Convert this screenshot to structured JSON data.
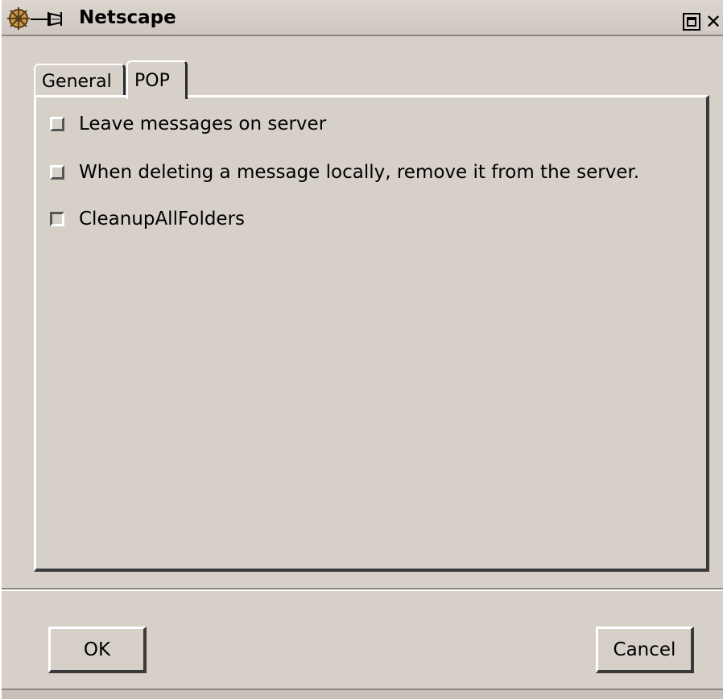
{
  "window": {
    "title": "Netscape",
    "icons": {
      "app": "netscape-ship-wheel-icon",
      "pin": "pin-icon",
      "maximize": "maximize-icon",
      "close": "close-icon"
    },
    "close_glyph": "✕"
  },
  "tabs": [
    {
      "label": "General",
      "selected": false
    },
    {
      "label": "POP",
      "selected": true
    }
  ],
  "options": [
    {
      "label": "Leave messages on server",
      "checked": false
    },
    {
      "label": "When deleting a message locally, remove it from the server.",
      "checked": false
    },
    {
      "label": "CleanupAllFolders",
      "checked": false
    }
  ],
  "buttons": {
    "ok_label": "OK",
    "cancel_label": "Cancel"
  },
  "colors": {
    "window_bg": "#d6d0c8",
    "highlight": "#ffffff",
    "shadow": "#3a3a3a"
  }
}
